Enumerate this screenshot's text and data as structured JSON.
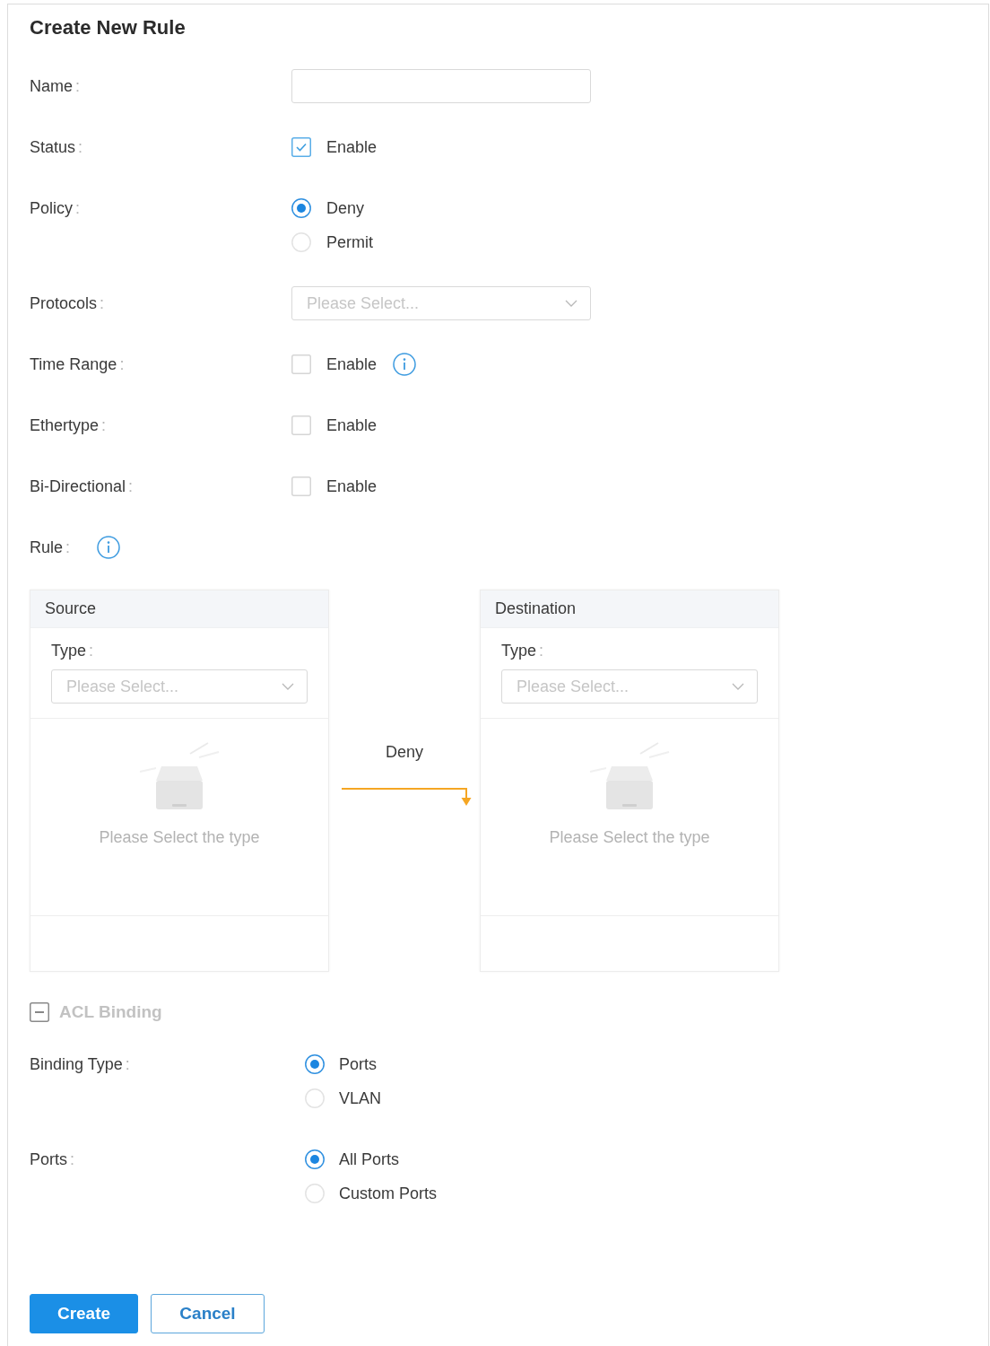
{
  "title": "Create New Rule",
  "fields": [
    {
      "kind": "text",
      "label": "Name",
      "colon": ":",
      "info": false
    },
    {
      "kind": "checkbox",
      "label": "Status",
      "colon": ":",
      "option": "Enable",
      "checked": true,
      "info": false
    },
    {
      "kind": "radio",
      "label": "Policy",
      "colon": ":",
      "info": false,
      "options": [
        {
          "label": "Deny",
          "selected": true
        },
        {
          "label": "Permit",
          "selected": false
        }
      ]
    },
    {
      "kind": "select",
      "label": "Protocols",
      "colon": ":",
      "placeholder": "Please Select...",
      "info": false
    },
    {
      "kind": "checkbox",
      "label": "Time Range",
      "colon": ":",
      "option": "Enable",
      "checked": false,
      "info": true
    },
    {
      "kind": "checkbox",
      "label": "Ethertype",
      "colon": ":",
      "option": "Enable",
      "checked": false,
      "info": false
    },
    {
      "kind": "checkbox",
      "label": "Bi-Directional",
      "colon": ":",
      "option": "Enable",
      "checked": false,
      "info": false
    }
  ],
  "rule": {
    "label": "Rule",
    "colon": ":",
    "info": true,
    "source": {
      "title": "Source",
      "type_label": "Type",
      "colon": ":",
      "placeholder": "Please Select...",
      "empty_text": "Please Select the type"
    },
    "action": "Deny",
    "destination": {
      "title": "Destination",
      "type_label": "Type",
      "colon": ":",
      "placeholder": "Please Select...",
      "empty_text": "Please Select the type"
    }
  },
  "binding": {
    "title": "ACL Binding",
    "expanded": true,
    "fields": [
      {
        "kind": "radio",
        "label": "Binding Type",
        "colon": ":",
        "options": [
          {
            "label": "Ports",
            "selected": true
          },
          {
            "label": "VLAN",
            "selected": false
          }
        ]
      },
      {
        "kind": "radio",
        "label": "Ports",
        "colon": ":",
        "options": [
          {
            "label": "All Ports",
            "selected": true
          },
          {
            "label": "Custom Ports",
            "selected": false
          }
        ]
      }
    ]
  },
  "buttons": [
    {
      "label": "Create",
      "kind": "primary"
    },
    {
      "label": "Cancel",
      "kind": "secondary"
    }
  ]
}
